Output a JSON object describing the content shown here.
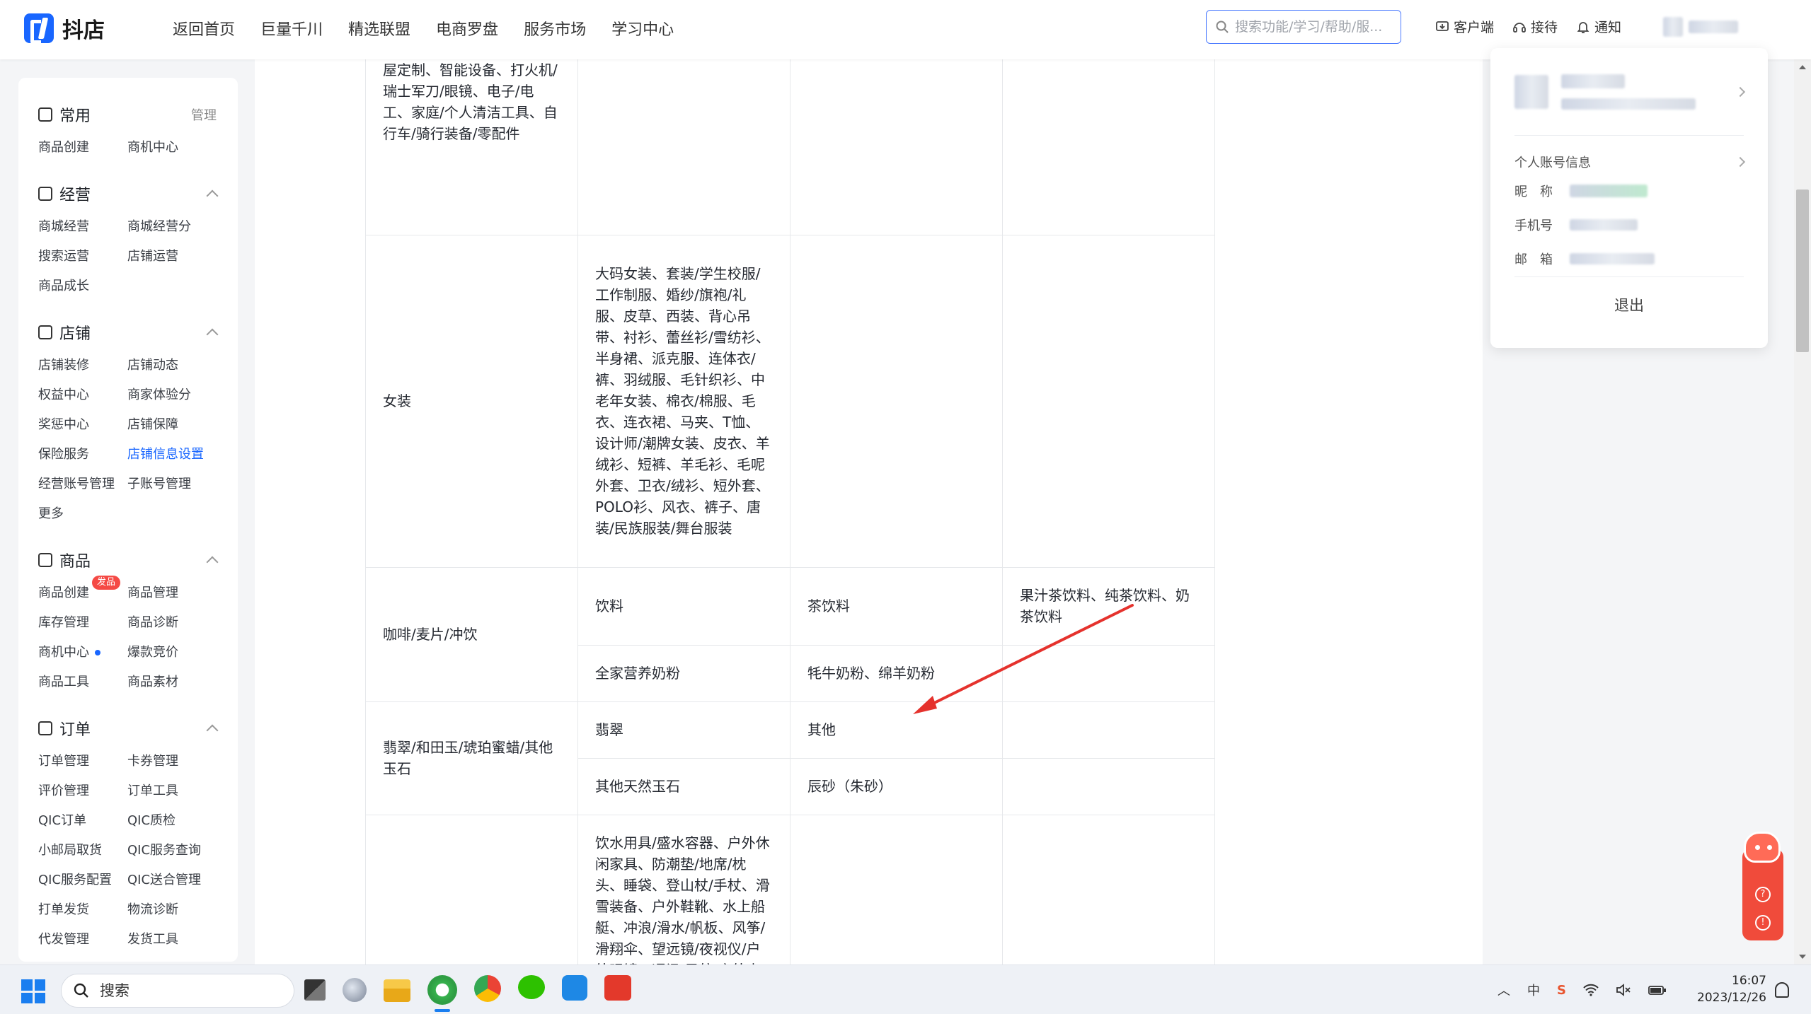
{
  "topbar": {
    "brand": "抖店",
    "nav": [
      "返回首页",
      "巨量千川",
      "精选联盟",
      "电商罗盘",
      "服务市场",
      "学习中心"
    ],
    "search_placeholder": "搜索功能/学习/帮助/服...",
    "actions": [
      {
        "label": "客户端",
        "icon": "download-icon"
      },
      {
        "label": "接待",
        "icon": "headset-icon"
      },
      {
        "label": "通知",
        "icon": "bell-icon"
      }
    ]
  },
  "sidebar": {
    "sections": [
      {
        "title": "常用",
        "extra": "管理",
        "icon": "folder-icon",
        "items": [
          "商品创建",
          "商机中心"
        ]
      },
      {
        "title": "经营",
        "icon": "chart-icon",
        "items": [
          "商城经营",
          "商城经营分",
          "搜索运营",
          "店铺运营",
          "商品成长"
        ]
      },
      {
        "title": "店铺",
        "icon": "shop-icon",
        "items": [
          "店铺装修",
          "店铺动态",
          "权益中心",
          "商家体验分",
          "奖惩中心",
          "店铺保障",
          "保险服务",
          "店铺信息设置",
          "经营账号管理",
          "子账号管理",
          "更多"
        ]
      },
      {
        "title": "商品",
        "icon": "goods-icon",
        "items": [
          "商品创建",
          "商品管理",
          "库存管理",
          "商品诊断",
          "商机中心",
          "爆款竞价",
          "商品工具",
          "商品素材"
        ]
      },
      {
        "title": "订单",
        "icon": "order-icon",
        "items": [
          "订单管理",
          "卡券管理",
          "评价管理",
          "订单工具",
          "QIC订单",
          "QIC质检",
          "小邮局取货",
          "QIC服务查询",
          "QIC服务配置",
          "QIC送合管理",
          "打单发货",
          "物流诊断",
          "代发管理",
          "发货工具"
        ]
      }
    ],
    "badge_new": "发品",
    "active_item": "店铺信息设置"
  },
  "table": {
    "rows": [
      {
        "c1": "屋定制、智能设备、打火机/瑞士军刀/眼镜、电子/电工、家庭/个人清洁工具、自行车/骑行装备/零配件",
        "c2": "",
        "c3": "",
        "c4": ""
      },
      {
        "c1": "女装",
        "c2": "大码女装、套装/学生校服/工作制服、婚纱/旗袍/礼服、皮草、西装、背心吊带、衬衫、蕾丝衫/雪纺衫、半身裙、派克服、连体衣/裤、羽绒服、毛针织衫、中老年女装、棉衣/棉服、毛衣、连衣裙、马夹、T恤、设计师/潮牌女装、皮衣、羊绒衫、短裤、羊毛衫、毛呢外套、卫衣/绒衫、短外套、POLO衫、风衣、裤子、唐装/民族服装/舞台服装",
        "c3": "",
        "c4": ""
      },
      {
        "c1": "咖啡/麦片/冲饮",
        "c2": "饮料",
        "c3": "茶饮料",
        "c4": "果汁茶饮料、纯茶饮料、奶茶饮料"
      },
      {
        "c2": "全家营养奶粉",
        "c3": "牦牛奶粉、绵羊奶粉",
        "c4": ""
      },
      {
        "c1": "翡翠/和田玉/琥珀蜜蜡/其他玉石",
        "c2": "翡翠",
        "c3": "其他",
        "c4": ""
      },
      {
        "c2": "其他天然玉石",
        "c3": "辰砂（朱砂）",
        "c4": ""
      },
      {
        "c1": "",
        "c2": "饮水用具/盛水容器、户外休闲家具、防潮垫/地席/枕头、睡袋、登山杖/手杖、滑雪装备、户外鞋靴、水上船艇、冲浪/滑水/帆板、风筝/滑翔伞、望远镜/夜视仪/户外眼镜、通讯/导航/户外表类、潜水装备、登山攀岩攀冰、防护/救生装",
        "c3": "",
        "c4": ""
      }
    ]
  },
  "account_popover": {
    "section_link": "个人账号信息",
    "fields": [
      {
        "key": "昵　称"
      },
      {
        "key": "手机号"
      },
      {
        "key": "邮　箱"
      }
    ],
    "logout": "退出"
  },
  "annotation": {
    "type": "arrow",
    "color": "#e5322d",
    "points_to": "辰砂（朱砂）"
  },
  "taskbar": {
    "search_placeholder": "搜索",
    "tray": [
      "中",
      "S"
    ],
    "time": "16:07",
    "date": "2023/12/26"
  }
}
